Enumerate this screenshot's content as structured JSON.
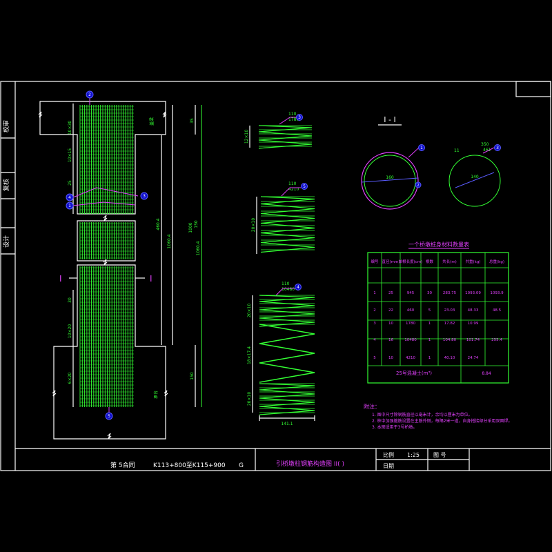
{
  "side_labels": [
    "校审",
    "复核",
    "设计"
  ],
  "section_label": "I - I",
  "section_marks": [
    "I",
    "I"
  ],
  "circle_left": {
    "dim": "160",
    "callout": "1",
    "callout2": "2"
  },
  "circle_right": {
    "dim": "140",
    "num1": "11",
    "num2": "350",
    "num3": "461",
    "callout": "3"
  },
  "table": {
    "title": "一个桥墩桩身材料数量表",
    "headers": [
      "编号",
      "直径(mm)",
      "单根长度(cm)",
      "根数",
      "共长(m)",
      "共重(kg)",
      "总重(kg)"
    ],
    "rows": [
      [
        "1",
        "25",
        "945",
        "30",
        "283.75",
        "1093.09",
        "1093.9"
      ],
      [
        "2",
        "22",
        "460",
        "5",
        "23.03",
        "48.33",
        "48.5"
      ],
      [
        "3",
        "10",
        "1780",
        "1",
        "17.82",
        "10.99",
        ""
      ],
      [
        "4",
        "16",
        "10480",
        "1",
        "104.80",
        "101.74",
        "255.4"
      ],
      [
        "5",
        "10",
        "4210",
        "1",
        "40.10",
        "24.74",
        ""
      ]
    ],
    "footer_label": "25号混凝土(m³)",
    "footer_value": "8.84"
  },
  "spirals": {
    "s1": {
      "top": "110",
      "bot": "1780",
      "callout": "3",
      "dim": "12×10"
    },
    "s2": {
      "top": "110",
      "bot": "4210",
      "callout": "5",
      "dim": "20×10"
    },
    "s3": {
      "top": "110",
      "bot": "10480",
      "callout": "4",
      "dim1": "20×10",
      "dim2": "18×17.4",
      "dim3": "20×10",
      "width": "141.1"
    }
  },
  "column_callouts": [
    "2",
    "4",
    "1",
    "3",
    "5"
  ],
  "column_dims": {
    "d1": "10×30",
    "d2": "10×15",
    "d3": "25",
    "d4": "30",
    "d5": "10×20",
    "d6": "6×20",
    "total1": "460.4",
    "total2": "1060.4",
    "right1": "35",
    "right2": "1060.4",
    "right3": "1000",
    "right4": "150",
    "right5": "150",
    "label1": "盖梁",
    "label2": "承台"
  },
  "notes": {
    "title": "附注：",
    "lines": [
      "1. 图中尺寸除钢筋直径以毫米计，余均以厘米为单位。",
      "2. 桩中加强箍筋设置在主筋外侧，每隔2米一道，自身搭接部分采用双面焊。",
      "3. 本图适用于3号桥墩。"
    ]
  },
  "title_block": {
    "section": "第 5合同",
    "range": "K113+800至K115+900",
    "suffix": "G",
    "drawing_title": "引桥墩柱钢筋构造图 II(  )",
    "scale_label": "比例",
    "scale_value": "1:25",
    "drawing_no_label": "图  号",
    "date_label": "日期"
  }
}
